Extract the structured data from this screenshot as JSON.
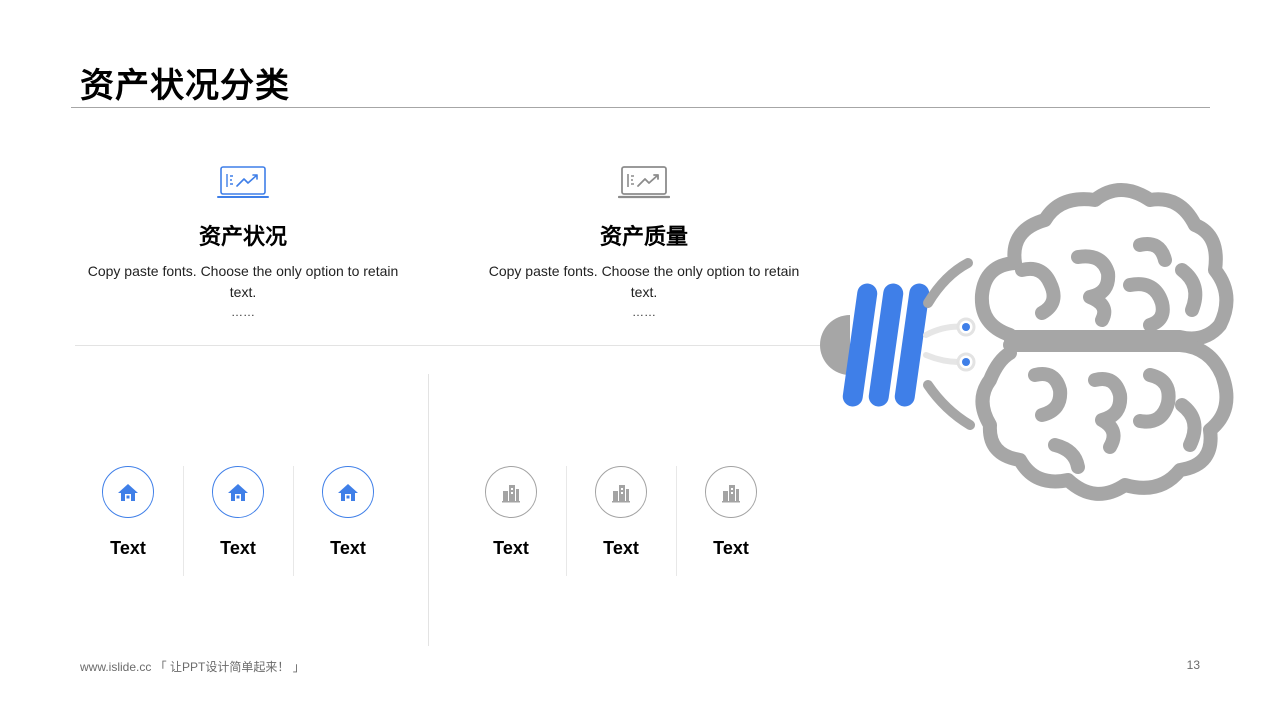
{
  "title": "资产状况分类",
  "columns": [
    {
      "heading": "资产状况",
      "description": "Copy paste fonts. Choose the only option to retain text.",
      "ellipsis": "……",
      "icon": "laptop-chart-icon",
      "color": "#3f7fe8"
    },
    {
      "heading": "资产质量",
      "description": "Copy paste fonts. Choose the only option to retain text.",
      "ellipsis": "……",
      "icon": "laptop-chart-icon",
      "color": "#8c8c8c"
    }
  ],
  "items_left": [
    {
      "label": "Text",
      "icon": "house-icon"
    },
    {
      "label": "Text",
      "icon": "house-icon"
    },
    {
      "label": "Text",
      "icon": "house-icon"
    }
  ],
  "items_right": [
    {
      "label": "Text",
      "icon": "buildings-icon"
    },
    {
      "label": "Text",
      "icon": "buildings-icon"
    },
    {
      "label": "Text",
      "icon": "buildings-icon"
    }
  ],
  "colors": {
    "accent": "#3f7fe8",
    "gray": "#a3a3a3",
    "brain": "#a6a6a6"
  },
  "footer": {
    "text": "www.islide.cc 「 让PPT设计简单起来！ 」",
    "page_number": "13"
  }
}
